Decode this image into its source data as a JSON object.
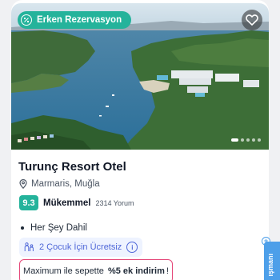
{
  "card": {
    "badge": {
      "label": "Erken Rezervasyon",
      "icon": "percent-icon",
      "color": "#24b39b"
    },
    "favorite_icon": "heart-icon",
    "carousel": {
      "total": 5,
      "active": 1
    },
    "title": "Turunç Resort Otel",
    "location": {
      "icon": "map-pin-icon",
      "text": "Marmaris, Muğla"
    },
    "rating": {
      "score": "9.3",
      "label": "Mükemmel",
      "reviews": "2314 Yorum"
    },
    "board_type": "Her Şey Dahil",
    "children": {
      "icon": "family-icon",
      "text": "2 Çocuk İçin Ücretsiz",
      "info_icon": "info-icon"
    },
    "promo": {
      "prefix": "Maximum ile sepette",
      "highlight": "%5 ek indirim",
      "suffix": "!"
    }
  },
  "side_tab": {
    "label": "ışmanı"
  },
  "colors": {
    "accent": "#24b39b",
    "info": "#4f67d8",
    "promo_border": "#e5487a",
    "side_tab": "#4d9fe9"
  }
}
